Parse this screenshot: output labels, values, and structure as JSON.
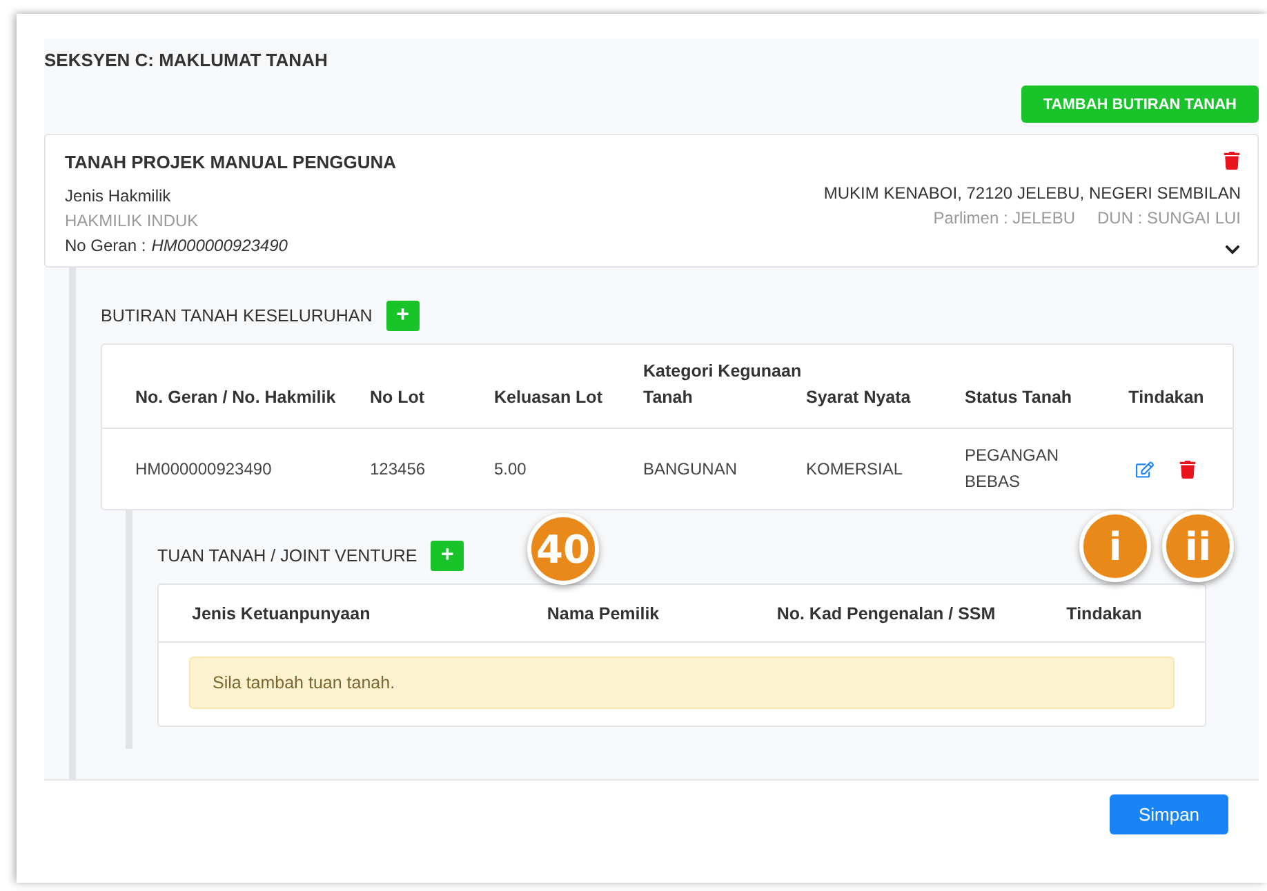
{
  "section_title": "SEKSYEN C: MAKLUMAT TANAH",
  "add_land_button": "TAMBAH BUTIRAN TANAH",
  "land_card": {
    "title": "TANAH PROJEK MANUAL PENGGUNA",
    "ownership_label": "Jenis Hakmilik",
    "ownership_value": "HAKMILIK INDUK",
    "grant_label": "No Geran :",
    "grant_value": "HM000000923490",
    "address": "MUKIM KENABOI, 72120 JELEBU, NEGERI SEMBILAN",
    "parliament": "Parlimen : JELEBU",
    "dun": "DUN : SUNGAI LUI",
    "expanded": true
  },
  "land_details": {
    "title": "BUTIRAN TANAH KESELURUHAN",
    "add_symbol": "+",
    "columns": [
      "No. Geran / No. Hakmilik",
      "No Lot",
      "Keluasan Lot",
      "Kategori Kegunaan Tanah",
      "Syarat Nyata",
      "Status Tanah",
      "Tindakan"
    ],
    "rows": [
      {
        "cells": [
          "HM000000923490",
          "123456",
          "5.00",
          "BANGUNAN",
          "KOMERSIAL",
          "PEGANGAN BEBAS"
        ]
      }
    ]
  },
  "owners": {
    "title": "TUAN TANAH / JOINT VENTURE",
    "add_symbol": "+",
    "columns": [
      "Jenis Ketuanpunyaan",
      "Nama Pemilik",
      "No. Kad Pengenalan / SSM",
      "Tindakan"
    ],
    "empty_message": "Sila tambah tuan tanah."
  },
  "save_button": "Simpan",
  "annotations": [
    {
      "label": "40"
    },
    {
      "label": "i"
    },
    {
      "label": "ii"
    }
  ]
}
